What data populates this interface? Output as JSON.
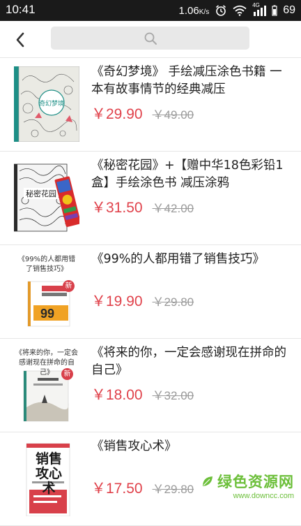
{
  "status_bar": {
    "time": "10:41",
    "network_speed": "1.06",
    "network_speed_unit": "K/s",
    "signal_label": "4G",
    "battery_level": "69"
  },
  "header": {
    "back_icon": "chevron-left-icon",
    "search_icon": "search-icon"
  },
  "products": [
    {
      "title": "《奇幻梦境》 手绘减压涂色书籍 一本有故事情节的经典减压",
      "price": "￥29.90",
      "original_price": "￥49.00",
      "cover_color": "#1d8f86"
    },
    {
      "title": "《秘密花园》+【赠中华18色彩铅1盒】手绘涂色书 减压涂鸦",
      "price": "￥31.50",
      "original_price": "￥42.00",
      "cover_color": "#2b2b2b"
    },
    {
      "title": "《99%的人都用错了销售技巧》",
      "price": "￥19.90",
      "original_price": "￥29.80",
      "cover_caption": "《99%的人都用错了销售技巧》",
      "cover_badge": "新"
    },
    {
      "title": "《将来的你，一定会感谢现在拼命的自己》",
      "price": "￥18.00",
      "original_price": "￥32.00",
      "cover_caption": "《将来的你，一定会感谢现在拼命的自己》",
      "cover_badge": "新"
    },
    {
      "title": "《销售攻心术》",
      "price": "￥17.50",
      "original_price": "￥29.80",
      "cover_caption": "销售攻心术"
    }
  ],
  "watermark": {
    "text": "绿色资源网",
    "url": "www.downcc.com"
  },
  "colors": {
    "price": "#e0424b",
    "status_bar": "#1a1a1a",
    "watermark": "#6cbf3a"
  }
}
